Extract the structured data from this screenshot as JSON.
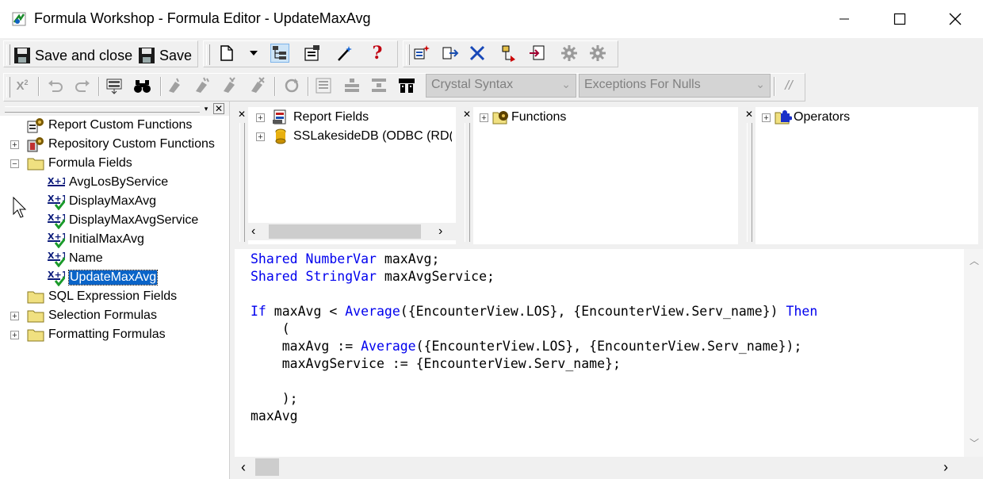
{
  "window": {
    "title": "Formula Workshop - Formula Editor - UpdateMaxAvg"
  },
  "toolbar": {
    "save_close_label": "Save and close",
    "save_label": "Save",
    "syntax_select": "Crystal Syntax",
    "null_select": "Exceptions For Nulls",
    "comment_label": "//"
  },
  "tree": {
    "items": [
      {
        "label": "Report Custom Functions",
        "icon": "custom-functions-icon"
      },
      {
        "label": "Repository Custom Functions",
        "icon": "repository-functions-icon"
      },
      {
        "label": "Formula Fields",
        "icon": "folder-icon"
      },
      {
        "label": "AvgLosByService",
        "icon": "formula-icon"
      },
      {
        "label": "DisplayMaxAvg",
        "icon": "formula-check-icon"
      },
      {
        "label": "DisplayMaxAvgService",
        "icon": "formula-check-icon"
      },
      {
        "label": "InitialMaxAvg",
        "icon": "formula-check-icon"
      },
      {
        "label": "Name",
        "icon": "formula-check-icon"
      },
      {
        "label": "UpdateMaxAvg",
        "icon": "formula-check-icon",
        "selected": true
      },
      {
        "label": "SQL Expression Fields",
        "icon": "folder-icon"
      },
      {
        "label": "Selection Formulas",
        "icon": "folder-icon"
      },
      {
        "label": "Formatting Formulas",
        "icon": "folder-icon"
      }
    ]
  },
  "explorers": {
    "fields": [
      "Report Fields",
      "SSLakesideDB (ODBC (RD("
    ],
    "functions": "Functions",
    "operators": "Operators"
  },
  "code_lines": [
    "Shared NumberVar maxAvg;",
    "Shared StringVar maxAvgService;",
    "",
    "If maxAvg < Average({EncounterView.LOS}, {EncounterView.Serv_name}) Then",
    "    (",
    "    maxAvg := Average({EncounterView.LOS}, {EncounterView.Serv_name});",
    "    maxAvgService := {EncounterView.Serv_name};",
    "",
    "    );",
    "maxAvg"
  ],
  "colors": {
    "keyword": "#0000ee",
    "selection": "#0a64c8"
  }
}
